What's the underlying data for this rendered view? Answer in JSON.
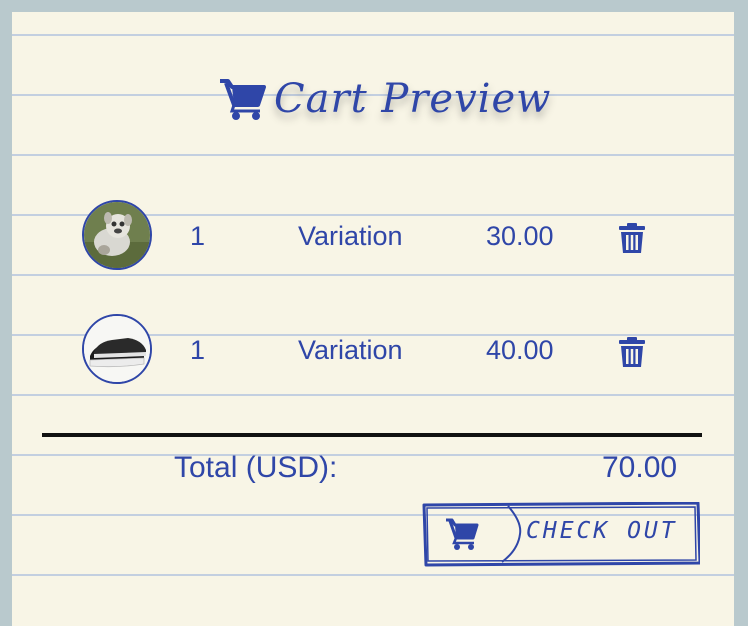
{
  "header": {
    "title": "Cart Preview",
    "icon": "cart-icon"
  },
  "cart": {
    "items": [
      {
        "qty": "1",
        "name": "Variation",
        "price": "30.00",
        "thumb": "dog-photo"
      },
      {
        "qty": "1",
        "name": "Variation",
        "price": "40.00",
        "thumb": "sneaker-photo"
      }
    ]
  },
  "summary": {
    "total_label": "Total (USD):",
    "total_value": "70.00"
  },
  "checkout": {
    "label": "CHECK OUT"
  },
  "colors": {
    "accent": "#2f46a8",
    "paper": "#f8f5e6",
    "rule": "#c3cfe0",
    "background": "#b9c9cd"
  }
}
